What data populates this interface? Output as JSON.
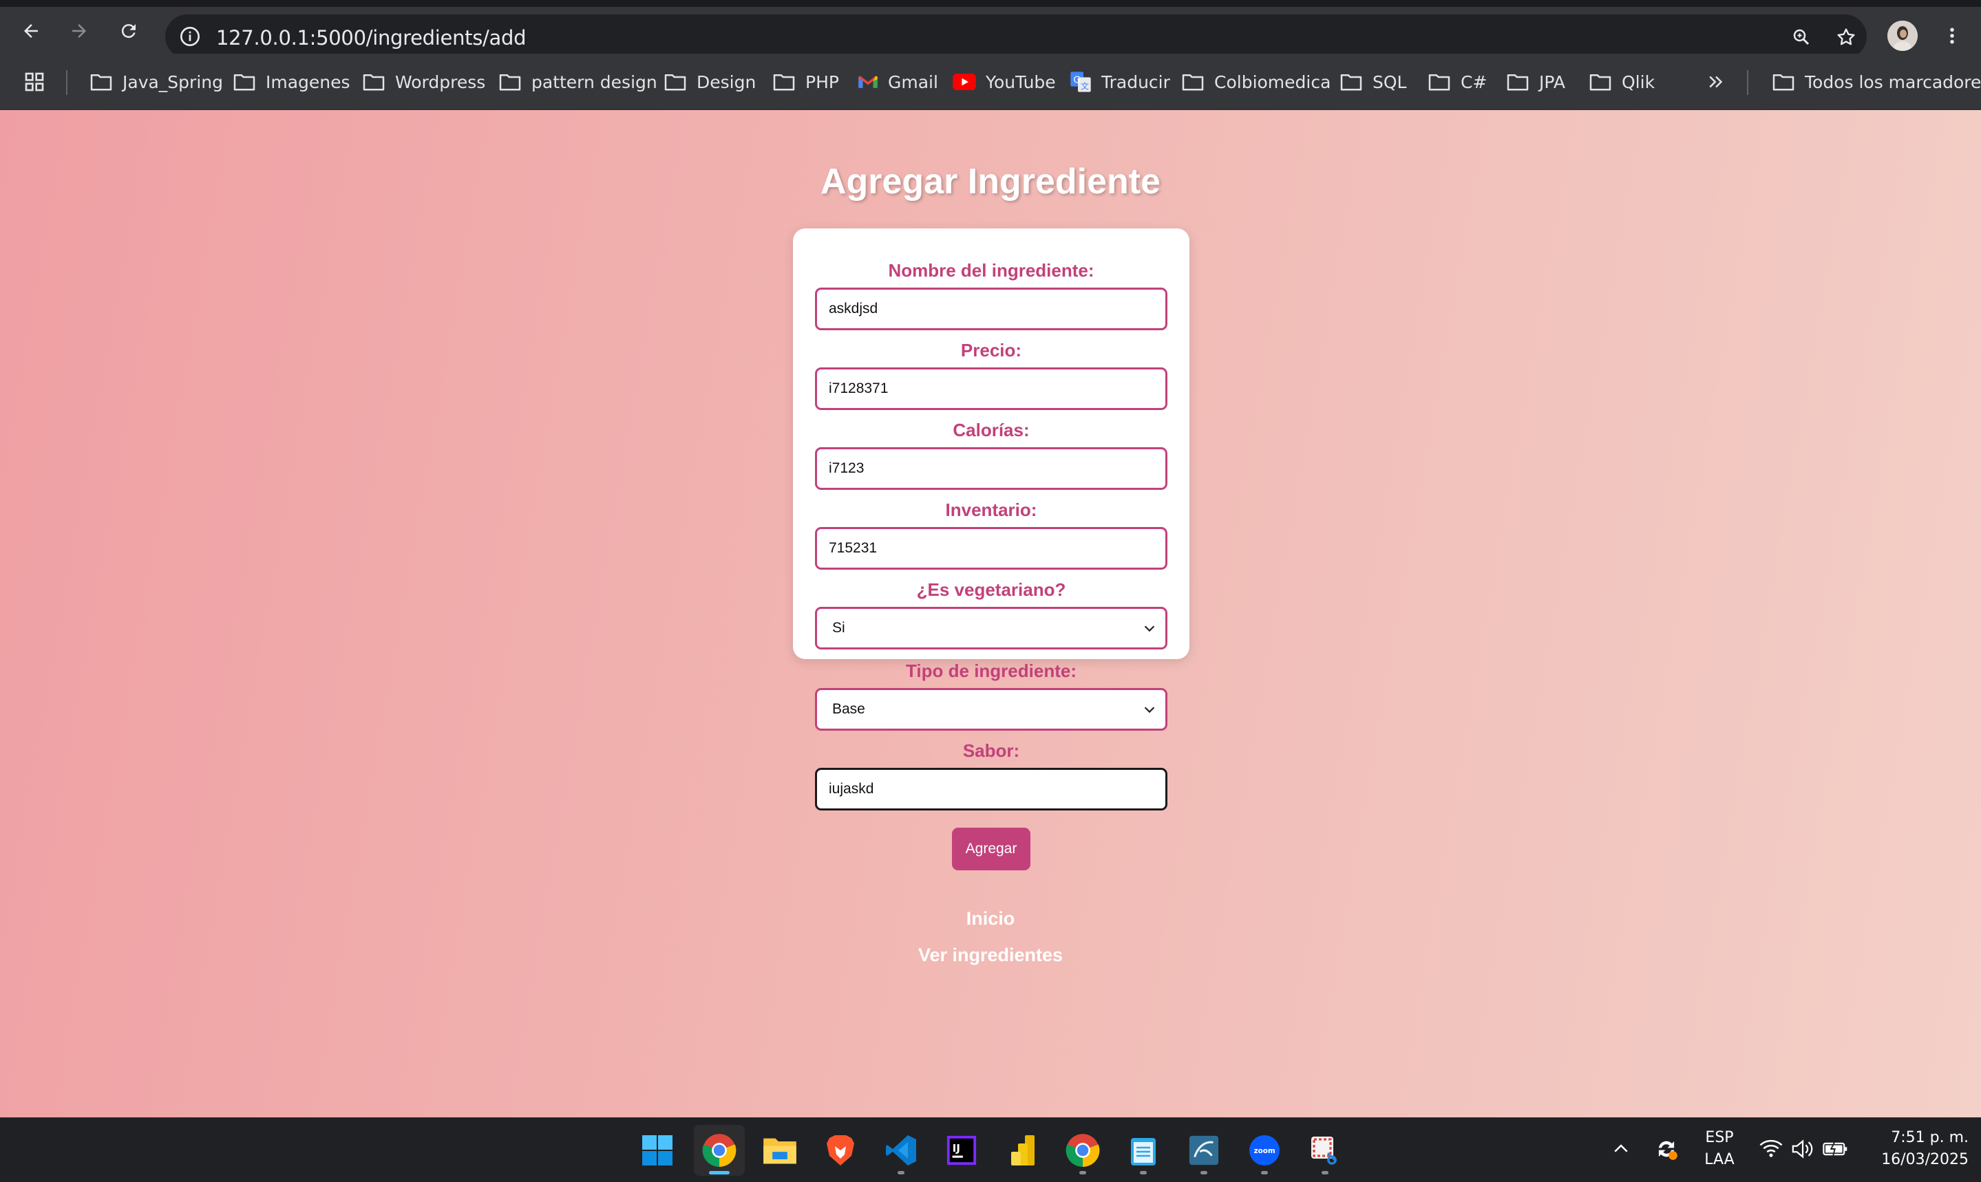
{
  "browser": {
    "url": "127.0.0.1:5000/ingredients/add",
    "bookmarks": [
      {
        "label": "Java_Spring",
        "icon": "folder-icon"
      },
      {
        "label": "Imagenes",
        "icon": "folder-icon"
      },
      {
        "label": "Wordpress",
        "icon": "folder-icon"
      },
      {
        "label": "pattern design",
        "icon": "folder-icon"
      },
      {
        "label": "Design",
        "icon": "folder-icon"
      },
      {
        "label": "PHP",
        "icon": "folder-icon"
      },
      {
        "label": "Gmail",
        "icon": "gmail-icon"
      },
      {
        "label": "YouTube",
        "icon": "youtube-icon"
      },
      {
        "label": "Traducir",
        "icon": "translate-icon"
      },
      {
        "label": "Colbiomedica",
        "icon": "folder-icon"
      },
      {
        "label": "SQL",
        "icon": "folder-icon"
      },
      {
        "label": "C#",
        "icon": "folder-icon"
      },
      {
        "label": "JPA",
        "icon": "folder-icon"
      },
      {
        "label": "Qlik",
        "icon": "folder-icon"
      }
    ],
    "all_bookmarks": "Todos los marcadores"
  },
  "page": {
    "title": "Agregar Ingrediente",
    "fields": {
      "nombre": {
        "label": "Nombre del ingrediente:",
        "value": "askdjsd"
      },
      "precio": {
        "label": "Precio:",
        "value": "i7128371"
      },
      "calorias": {
        "label": "Calorías:",
        "value": "i7123"
      },
      "inventario": {
        "label": "Inventario:",
        "value": "715231"
      },
      "vegetariano": {
        "label": "¿Es vegetariano?",
        "value": "Si"
      },
      "tipo": {
        "label": "Tipo de ingrediente:",
        "value": "Base"
      },
      "sabor": {
        "label": "Sabor:",
        "value": "iujaskd"
      }
    },
    "submit": "Agregar",
    "links": {
      "inicio": "Inicio",
      "ver": "Ver ingredientes"
    }
  },
  "taskbar": {
    "apps": [
      "windows-start-icon",
      "chrome-icon",
      "file-explorer-icon",
      "brave-icon",
      "vscode-icon",
      "intellij-icon",
      "power-bi-icon",
      "chrome-profile-icon",
      "notepad-icon",
      "mysql-workbench-icon",
      "zoom-icon",
      "snipping-tool-icon"
    ],
    "lang": "ESP",
    "layout": "LAA",
    "time": "7:51 p. m.",
    "date": "16/03/2025"
  },
  "colors": {
    "accent": "#c2417a",
    "page_bg_start": "#ef9fa3",
    "page_bg_end": "#f3d0c8"
  }
}
